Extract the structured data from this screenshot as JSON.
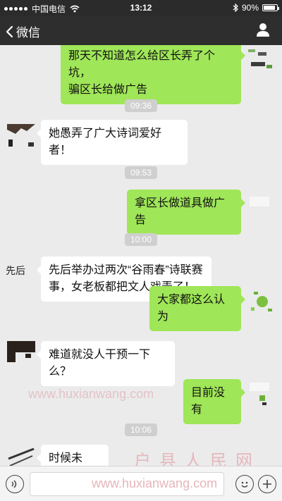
{
  "status_bar": {
    "carrier": "中国电信",
    "time": "13:12",
    "battery": "90%",
    "battery_level": 0.9,
    "icons": [
      "signal-dots-icon",
      "wifi-icon",
      "bluetooth-icon",
      "battery-icon"
    ]
  },
  "nav": {
    "back_label": "微信",
    "icons": [
      "chevron-left-icon",
      "contact-icon"
    ]
  },
  "messages": [
    {
      "type": "outgoing",
      "text_lines": [
        "那天不知道怎么给区长弄了个坑，",
        "骗区长给做广告"
      ]
    },
    {
      "type": "time",
      "text": "09:36"
    },
    {
      "type": "incoming",
      "text_lines": [
        "她愚弄了广大诗词爱好者！"
      ]
    },
    {
      "type": "time",
      "text": "09:53"
    },
    {
      "type": "outgoing",
      "text_lines": [
        "拿区长做道具做广告"
      ]
    },
    {
      "type": "time",
      "text": "10:00"
    },
    {
      "type": "incoming",
      "avatar_text": "先后",
      "text_lines": [
        "先后举办过两次“谷雨春”诗联赛",
        "事，女老板都把文人戏弄了！"
      ]
    },
    {
      "type": "outgoing",
      "text_lines": [
        "大家都这么认为"
      ]
    },
    {
      "type": "incoming",
      "text_lines": [
        "难道就没人干预一下么？"
      ]
    },
    {
      "type": "outgoing",
      "text_lines": [
        "目前没有"
      ]
    },
    {
      "type": "time",
      "text": "10:06"
    },
    {
      "type": "incoming",
      "text_lines": [
        "时候未到。"
      ]
    }
  ],
  "watermarks": {
    "url": "www.huxianwang.com",
    "brand": "户县人民网",
    "input_url": "www.huxianwang.com"
  },
  "input_bar": {
    "icons": [
      "voice-icon",
      "emoji-icon",
      "plus-icon"
    ]
  },
  "colors": {
    "outgoing_bubble": "#9fe658",
    "incoming_bubble": "#ffffff",
    "nav_background": "#2e2e2e",
    "chat_background": "#ebebeb"
  }
}
